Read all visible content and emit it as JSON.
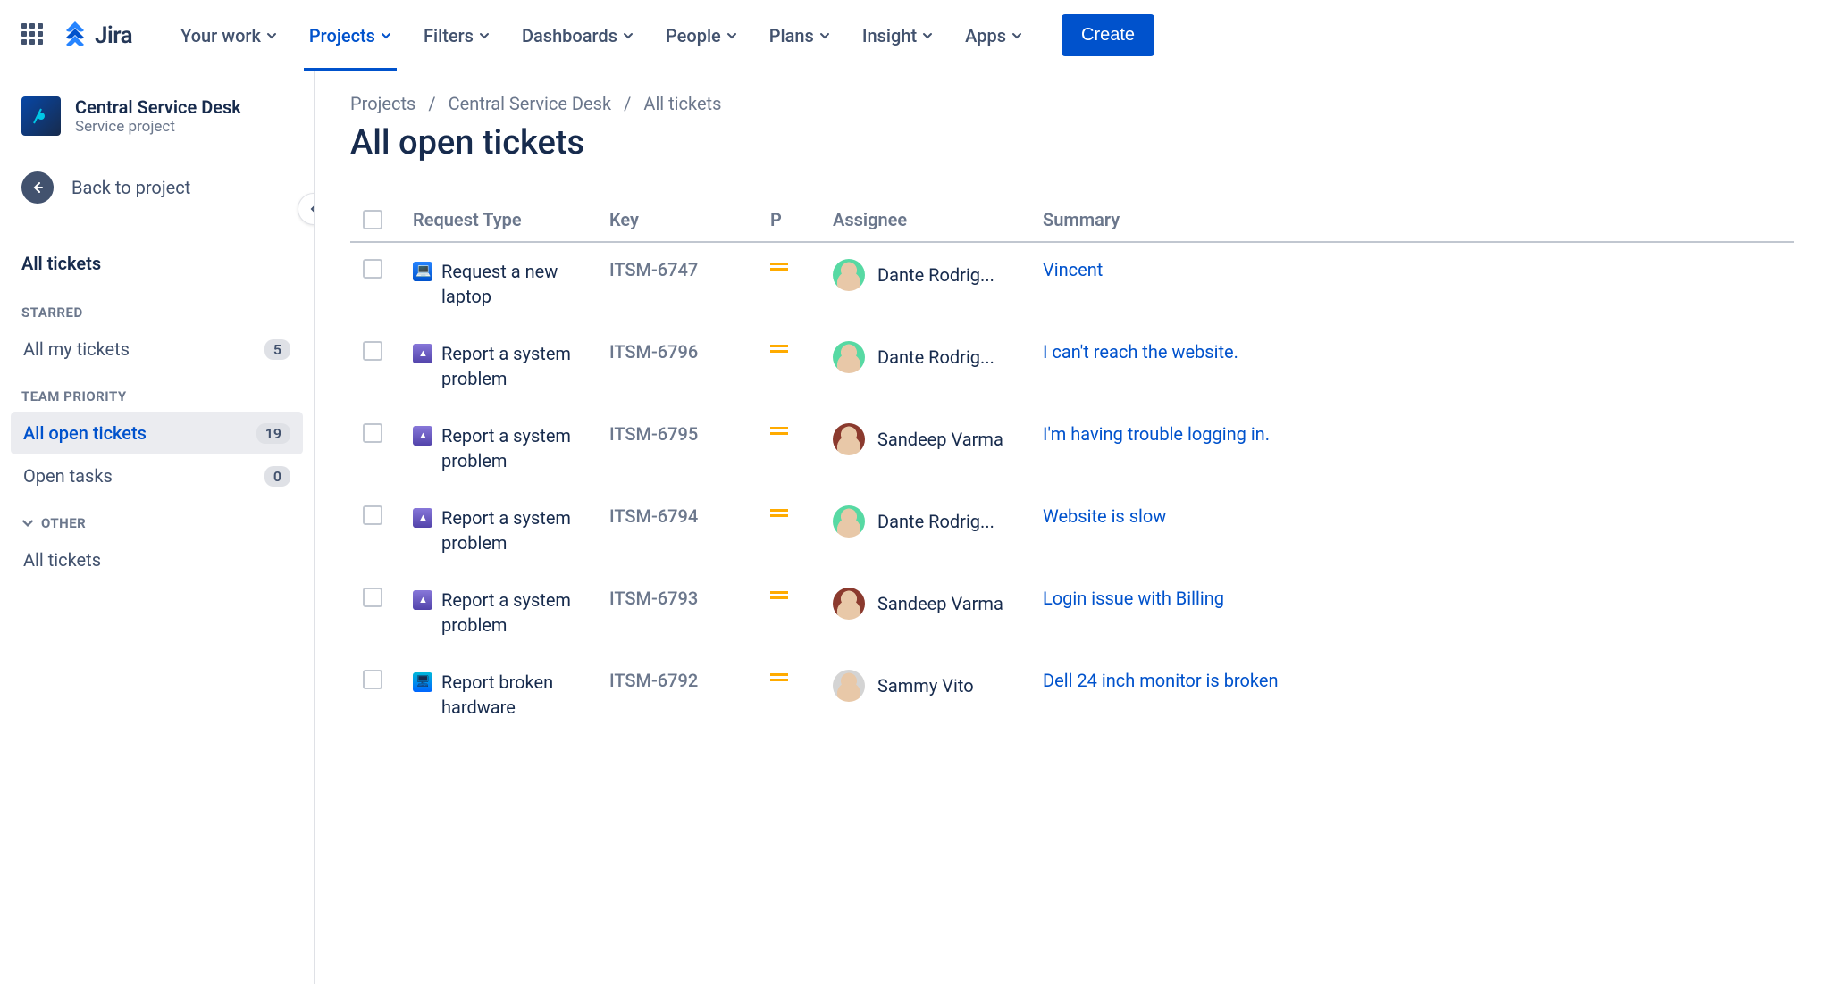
{
  "brand": "Jira",
  "nav": {
    "items": [
      {
        "label": "Your work"
      },
      {
        "label": "Projects",
        "active": true
      },
      {
        "label": "Filters"
      },
      {
        "label": "Dashboards"
      },
      {
        "label": "People"
      },
      {
        "label": "Plans"
      },
      {
        "label": "Insight"
      },
      {
        "label": "Apps"
      }
    ],
    "create": "Create"
  },
  "sidebar": {
    "project_name": "Central Service Desk",
    "project_type": "Service project",
    "back_label": "Back to project",
    "all_tickets": "All tickets",
    "starred_label": "STARRED",
    "starred_items": [
      {
        "label": "All my tickets",
        "count": "5"
      }
    ],
    "team_label": "TEAM PRIORITY",
    "team_items": [
      {
        "label": "All open tickets",
        "count": "19",
        "active": true
      },
      {
        "label": "Open tasks",
        "count": "0"
      }
    ],
    "other_label": "OTHER",
    "other_items": [
      {
        "label": "All tickets"
      }
    ]
  },
  "breadcrumb": [
    "Projects",
    "Central Service Desk",
    "All tickets"
  ],
  "page_title": "All open tickets",
  "columns": {
    "type": "Request Type",
    "key": "Key",
    "p": "P",
    "assignee": "Assignee",
    "summary": "Summary"
  },
  "rows": [
    {
      "type": "Request a new laptop",
      "type_icon": "laptop",
      "key": "ITSM-6747",
      "assignee": "Dante Rodrig...",
      "avatar_bg": "#57D9A3",
      "summary": "Vincent"
    },
    {
      "type": "Report a system problem",
      "type_icon": "system",
      "key": "ITSM-6796",
      "assignee": "Dante Rodrig...",
      "avatar_bg": "#57D9A3",
      "summary": "I can't reach the website."
    },
    {
      "type": "Report a system problem",
      "type_icon": "system",
      "key": "ITSM-6795",
      "assignee": "Sandeep Varma",
      "avatar_bg": "#8B3A2E",
      "summary": "I'm having trouble logging in."
    },
    {
      "type": "Report a system problem",
      "type_icon": "system",
      "key": "ITSM-6794",
      "assignee": "Dante Rodrig...",
      "avatar_bg": "#57D9A3",
      "summary": "Website is slow"
    },
    {
      "type": "Report a system problem",
      "type_icon": "system",
      "key": "ITSM-6793",
      "assignee": "Sandeep Varma",
      "avatar_bg": "#8B3A2E",
      "summary": "Login issue with Billing"
    },
    {
      "type": "Report broken hardware",
      "type_icon": "hardware",
      "key": "ITSM-6792",
      "assignee": "Sammy Vito",
      "avatar_bg": "#D4D4D4",
      "summary": "Dell 24 inch monitor is broken"
    }
  ]
}
